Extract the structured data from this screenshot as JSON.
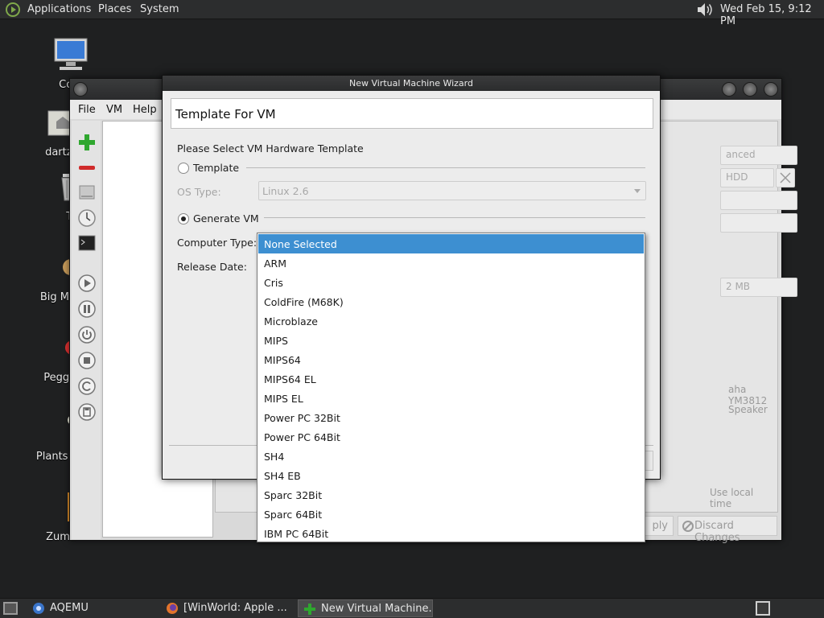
{
  "top_panel": {
    "menus": [
      "Applications",
      "Places",
      "System"
    ],
    "clock": "Wed Feb 15,  9:12 PM"
  },
  "desktop_icons": [
    {
      "label": "Com",
      "icon": "computer-icon"
    },
    {
      "label": "dartz's",
      "icon": "home-folder-icon"
    },
    {
      "label": "Tr",
      "icon": "trash-icon"
    },
    {
      "label": "Big Mon",
      "icon": "game-icon"
    },
    {
      "label": "Peggle",
      "icon": "game-icon"
    },
    {
      "label": "Plants vs",
      "icon": "game-icon"
    },
    {
      "label": "Zuma",
      "icon": "game-icon"
    }
  ],
  "aqemu": {
    "menu": [
      "File",
      "VM",
      "Help"
    ],
    "background_fragments": {
      "advanced": "anced",
      "hdd": "HDD",
      "memory": "2 MB",
      "sound_card_1": "aha YM3812",
      "sound_card_2": "Speaker",
      "local_time": "Use local time"
    },
    "apply_label": "ply",
    "discard_label": "Discard Changes"
  },
  "wizard": {
    "title": "New Virtual Machine Wizard",
    "header": "Template For VM",
    "prompt": "Please Select VM Hardware Template",
    "template_radio": "Template",
    "os_type_label": "OS Type:",
    "os_type_value": "Linux 2.6",
    "generate_radio": "Generate VM",
    "computer_type_label": "Computer Type:",
    "release_date_label": "Release Date:"
  },
  "dropdown": {
    "selected": "None Selected",
    "options": [
      "None Selected",
      "ARM",
      "Cris",
      "ColdFire (M68K)",
      "Microblaze",
      "MIPS",
      "MIPS64",
      "MIPS64 EL",
      "MIPS EL",
      "Power PC 32Bit",
      "Power PC 64Bit",
      "SH4",
      "SH4 EB",
      "Sparc 32Bit",
      "Sparc 64Bit",
      "IBM PC 64Bit"
    ]
  },
  "taskbar": {
    "tasks": [
      {
        "label": "AQEMU",
        "icon": "aqemu-icon"
      },
      {
        "label": "[WinWorld: Apple ...",
        "icon": "firefox-icon"
      },
      {
        "label": "New Virtual Machine...",
        "icon": "add-icon"
      }
    ]
  },
  "colors": {
    "selection": "#3d8fd1",
    "panel": "#2c2d2e",
    "desktop": "#1f2021"
  }
}
